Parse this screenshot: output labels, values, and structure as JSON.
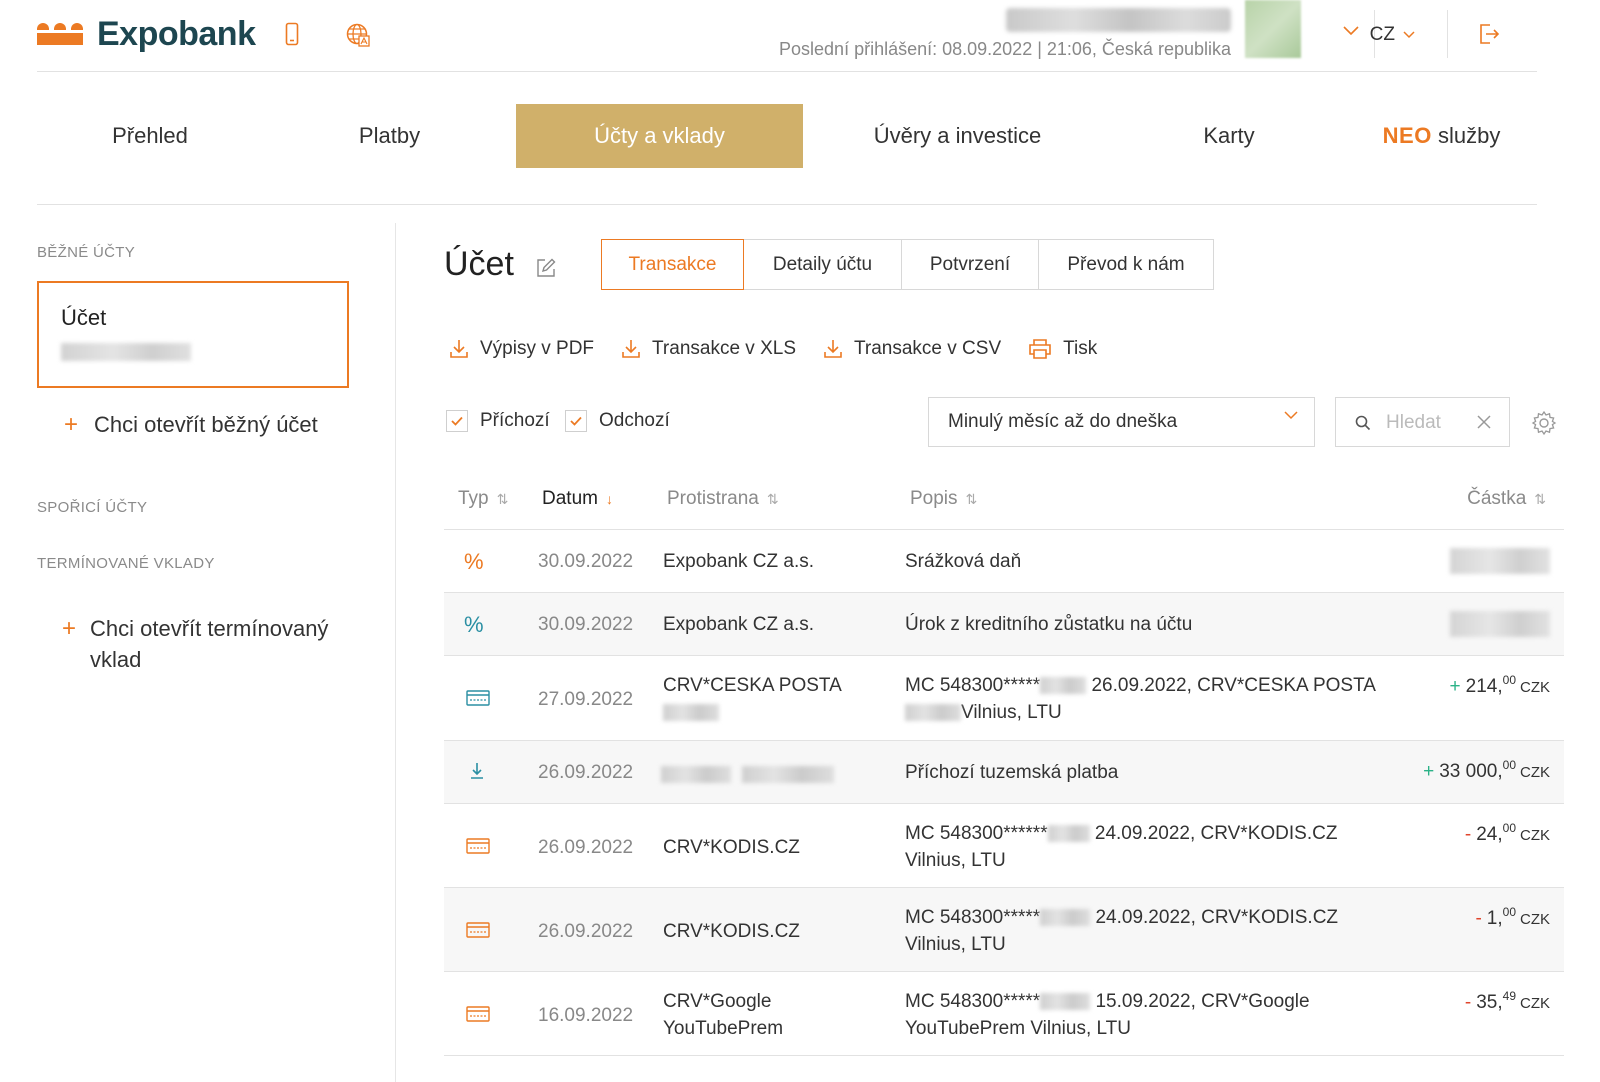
{
  "header": {
    "brand": "Expobank",
    "last_login": "Poslední přihlášení: 08.09.2022 | 21:06, Česká republika",
    "language": "CZ"
  },
  "nav": {
    "items": [
      {
        "label": "Přehled",
        "active": false
      },
      {
        "label": "Platby",
        "active": false
      },
      {
        "label": "Účty a vklady",
        "active": true
      },
      {
        "label": "Úvěry a investice",
        "active": false
      },
      {
        "label": "Karty",
        "active": false
      }
    ],
    "neo_brand": "NEO",
    "neo_label": "služby"
  },
  "sidebar": {
    "current_accounts_heading": "BĚŽNÉ ÚČTY",
    "account_card_title": "Účet",
    "open_current_account": "Chci otevřít běžný účet",
    "savings_heading": "SPOŘICÍ ÚČTY",
    "term_deposits_heading": "TERMÍNOVANÉ VKLADY",
    "open_term_deposit_line1": "Chci otevřít termínovaný",
    "open_term_deposit_line2": "vklad"
  },
  "main": {
    "title": "Účet",
    "tabs": [
      "Transakce",
      "Detaily účtu",
      "Potvrzení",
      "Převod k nám"
    ],
    "active_tab": "Transakce",
    "actions": [
      "Výpisy v PDF",
      "Transakce v XLS",
      "Transakce v CSV",
      "Tisk"
    ],
    "filters": {
      "incoming_label": "Příchozí",
      "incoming_checked": true,
      "outgoing_label": "Odchozí",
      "outgoing_checked": true,
      "period": "Minulý měsíc až do dneška",
      "search_placeholder": "Hledat"
    }
  },
  "table": {
    "columns": [
      "Typ",
      "Datum",
      "Protistrana",
      "Popis",
      "Částka"
    ],
    "sorted_column": "Datum",
    "rows": [
      {
        "type": "percent",
        "date": "30.09.2022",
        "party": "Expobank CZ a.s.",
        "party2": "",
        "desc1": "Srážková daň",
        "desc1b": "",
        "desc2": "",
        "sign": "",
        "amount": "",
        "decimals": "",
        "currency": ""
      },
      {
        "type": "percent",
        "date": "30.09.2022",
        "party": "Expobank CZ a.s.",
        "party2": "",
        "desc1": "Úrok z kreditního zůstatku na účtu",
        "desc1b": "",
        "desc2": "",
        "sign": "",
        "amount": "",
        "decimals": "",
        "currency": ""
      },
      {
        "type": "card",
        "date": "27.09.2022",
        "party": "CRV*CESKA POSTA",
        "party2": "",
        "desc1": "MC 548300*****",
        "desc1b": "26.09.2022, CRV*CESKA POSTA",
        "desc2": "Vilnius, LTU",
        "sign": "+",
        "amount": "214,",
        "decimals": "00",
        "currency": "CZK"
      },
      {
        "type": "incoming",
        "date": "26.09.2022",
        "party": "",
        "party2": "",
        "desc1": "Příchozí tuzemská platba",
        "desc1b": "",
        "desc2": "",
        "sign": "+",
        "amount": "33 000,",
        "decimals": "00",
        "currency": "CZK"
      },
      {
        "type": "card",
        "date": "26.09.2022",
        "party": "CRV*KODIS.CZ",
        "party2": "",
        "desc1": "MC 548300******",
        "desc1b": "24.09.2022, CRV*KODIS.CZ",
        "desc2": "Vilnius, LTU",
        "sign": "-",
        "amount": "24,",
        "decimals": "00",
        "currency": "CZK"
      },
      {
        "type": "card",
        "date": "26.09.2022",
        "party": "CRV*KODIS.CZ",
        "party2": "",
        "desc1": "MC 548300*****",
        "desc1b": "24.09.2022, CRV*KODIS.CZ",
        "desc2": "Vilnius, LTU",
        "sign": "-",
        "amount": "1,",
        "decimals": "00",
        "currency": "CZK"
      },
      {
        "type": "card",
        "date": "16.09.2022",
        "party": "CRV*Google",
        "party2": "YouTubePrem",
        "desc1": "MC 548300*****",
        "desc1b": "15.09.2022, CRV*Google",
        "desc2": "YouTubePrem Vilnius, LTU",
        "sign": "-",
        "amount": "35,",
        "decimals": "49",
        "currency": "CZK"
      }
    ]
  },
  "colors": {
    "accent": "#ec7a23",
    "nav_active": "#d0b06a",
    "brand_text": "#1d4650",
    "teal_icon": "#2a8fa3",
    "positive": "#2bb287",
    "negative": "#e0452c"
  },
  "icons": [
    "logo-mark",
    "phone-icon",
    "globe-icon",
    "chevron-down-icon",
    "logout-icon",
    "edit-icon",
    "download-icon",
    "print-icon",
    "check-icon",
    "search-icon",
    "close-icon",
    "gear-icon",
    "sort-icon",
    "percent-icon",
    "card-icon",
    "incoming-icon"
  ]
}
